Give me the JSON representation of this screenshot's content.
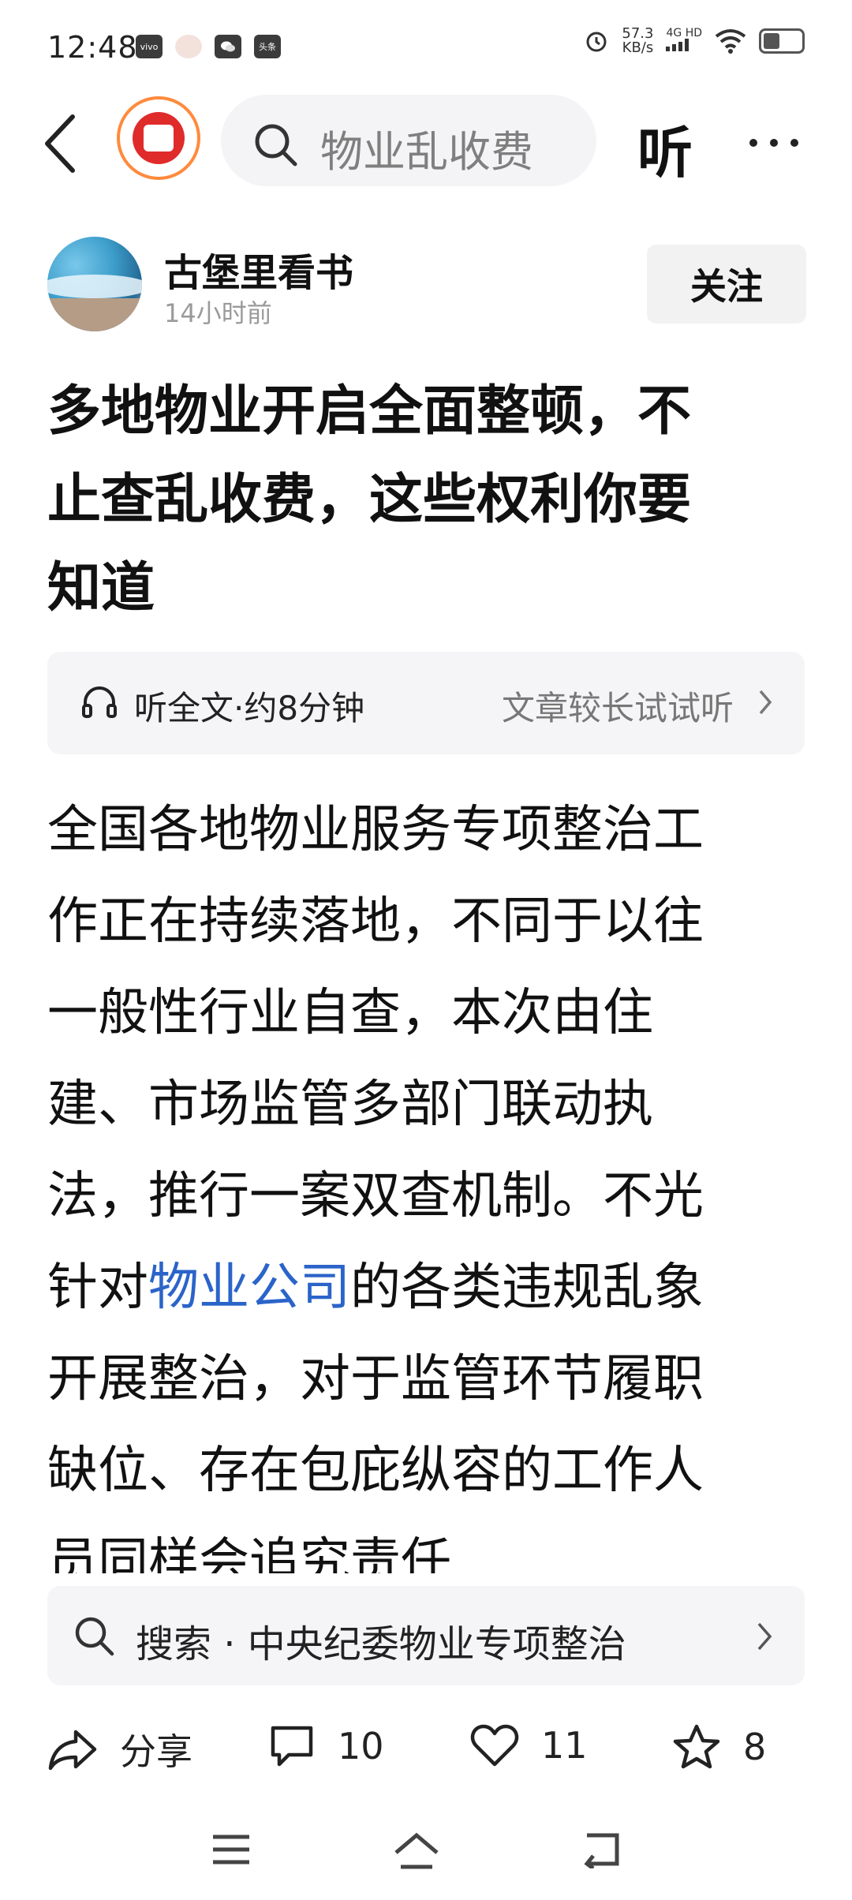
{
  "status_bar": {
    "time": "12:48",
    "app_icons": [
      "vivo",
      "avatar",
      "wechat",
      "头条"
    ],
    "net_speed": "57.3",
    "net_unit": "KB/s",
    "net_type": "4G HD"
  },
  "top_bar": {
    "search_placeholder": "物业乱收费",
    "listen_label": "听"
  },
  "author": {
    "name": "古堡里看书",
    "time": "14小时前",
    "follow_label": "关注"
  },
  "title_lines": [
    "多地物业开启全面整顿，不",
    "止查乱收费，这些权利你要",
    "知道"
  ],
  "listen_bar": {
    "left": "听全文·约8分钟",
    "right": "文章较长试试听"
  },
  "article": {
    "lines": [
      "全国各地物业服务专项整治工",
      "作正在持续落地，不同于以往",
      "一般性行业自查，本次由住",
      "建、市场监管多部门联动执",
      "法，推行一案双查机制。不光"
    ],
    "line6_pre": "针对",
    "line6_link": "物业公司",
    "line6_post": "的各类违规乱象",
    "lines_after": [
      "开展整治，对于监管环节履职",
      "缺位、存在包庇纵容的工作人",
      "员同样会追究责任"
    ]
  },
  "search_suggest": "搜索 · 中央纪委物业专项整治",
  "actions": {
    "share": "分享",
    "comments": "10",
    "likes": "11",
    "favorites": "8"
  },
  "colors": {
    "link": "#2b64c9",
    "accent": "#e02b2b"
  }
}
